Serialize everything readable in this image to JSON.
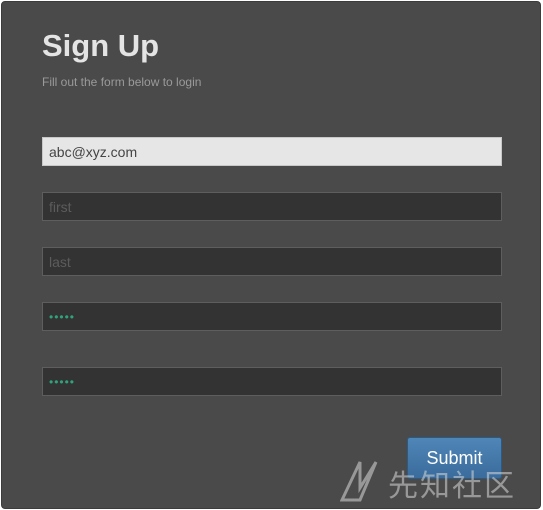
{
  "form": {
    "title": "Sign Up",
    "subtitle": "Fill out the form below to login",
    "email": {
      "value": "abc@xyz.com"
    },
    "first_name": {
      "placeholder": "first"
    },
    "last_name": {
      "placeholder": "last"
    },
    "password": {
      "value": "•••••"
    },
    "confirm_password": {
      "value": "•••••"
    },
    "submit_label": "Submit"
  },
  "watermark": {
    "text": "先知社区",
    "icon": "xianzhi-logo-icon"
  },
  "colors": {
    "panel_bg": "#4a4a4a",
    "field_bg": "#333333",
    "active_field_bg": "#e6e6e6",
    "button_bg": "#3f74a6",
    "password_dots": "#2fa37c"
  }
}
